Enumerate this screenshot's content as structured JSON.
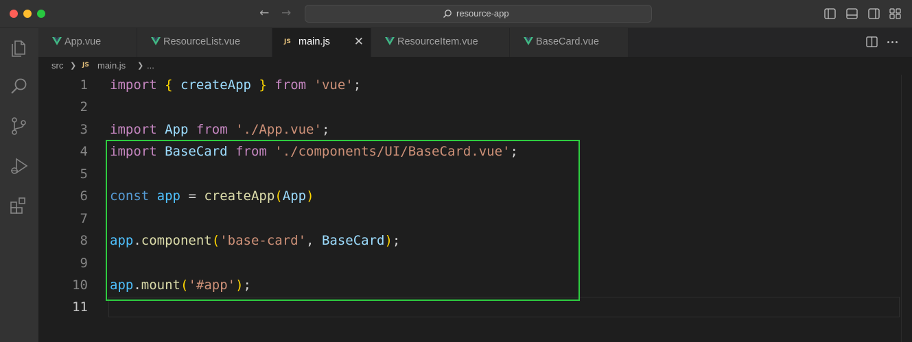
{
  "window": {
    "search_text": "resource-app"
  },
  "tabs": [
    {
      "label": "App.vue",
      "type": "vue",
      "active": false
    },
    {
      "label": "ResourceList.vue",
      "type": "vue",
      "active": false
    },
    {
      "label": "main.js",
      "type": "js",
      "active": true,
      "close": "✕"
    },
    {
      "label": "ResourceItem.vue",
      "type": "vue",
      "active": false
    },
    {
      "label": "BaseCard.vue",
      "type": "vue",
      "active": false
    }
  ],
  "file_badge": "JS",
  "breadcrumb": {
    "folder": "src",
    "file": "main.js",
    "rest": "..."
  },
  "editor": {
    "line_numbers": [
      "1",
      "2",
      "3",
      "4",
      "5",
      "6",
      "7",
      "8",
      "9",
      "10",
      "11"
    ],
    "current_line": "11",
    "code": {
      "l1": [
        "import",
        "{",
        "createApp",
        "}",
        "from",
        "'vue'",
        ";"
      ],
      "l3": [
        "import",
        "App",
        "from",
        "'./App.vue'",
        ";"
      ],
      "l4": [
        "import",
        "BaseCard",
        "from",
        "'./components/UI/BaseCard.vue'",
        ";"
      ],
      "l6": [
        "const",
        "app",
        "=",
        "createApp",
        "(",
        "App",
        ")"
      ],
      "l8": [
        "app",
        ".",
        "component",
        "(",
        "'base-card'",
        ",",
        "BaseCard",
        ")",
        ";"
      ],
      "l10": [
        "app",
        ".",
        "mount",
        "(",
        "'#app'",
        ")",
        ";"
      ]
    }
  },
  "colors": {
    "highlight_border": "#2ecc40",
    "keyword": "#c586c0",
    "string": "#ce9178",
    "function": "#dcdcaa",
    "variable": "#9cdcfe",
    "vue_logo": "#41b883",
    "js_badge": "#e5c07b"
  },
  "icons": {
    "activity_bar": [
      "explorer-icon",
      "search-icon",
      "source-control-icon",
      "run-debug-icon",
      "extensions-icon"
    ],
    "title_bar_right": [
      "toggle-primary-sidebar-icon",
      "toggle-panel-icon",
      "toggle-secondary-sidebar-icon",
      "customize-layout-icon"
    ],
    "editor_actions": [
      "split-editor-icon",
      "more-actions-icon"
    ]
  }
}
